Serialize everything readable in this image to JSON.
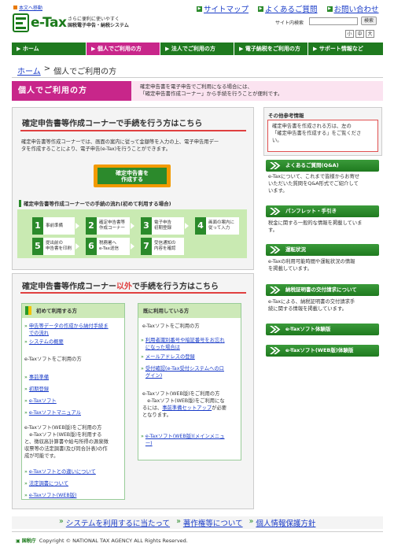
{
  "header": {
    "skip_link": "本文へ移動",
    "logo_text": "e-Tax",
    "logo_sub1": "さらに便利に使いやすく",
    "logo_sub2": "国税電子申告・納税システム",
    "toplinks": [
      "サイトマップ",
      "よくあるご質問",
      "お問い合わせ"
    ],
    "search_label": "サイト内検索",
    "search_button": "検索",
    "size_buttons": [
      "小",
      "中",
      "大"
    ]
  },
  "nav": [
    "ホーム",
    "個人でご利用の方",
    "法人でご利用の方",
    "電子納税をご利用の方",
    "サポート情報など"
  ],
  "breadcrumb": {
    "home": "ホーム",
    "sep": ">",
    "current": "個人でご利用の方"
  },
  "page_head": {
    "title": "個人でご利用の方",
    "desc1": "確定申告書を電子申告でご利用になる場合には、",
    "desc2": "「確定申告書作成コーナー」から手続を行うことが便利です。"
  },
  "main": {
    "title": "確定申告書等作成コーナーで手続を行う方はこちら",
    "text1": "確定申告書等作成コーナーでは、画面の案内に従って金額等を入力の上、電子申告用デー",
    "text2": "タを作成することにより、電子申告(e-Tax)を行うことができます。",
    "button_line1": "確定申告書を",
    "button_line2": "作成する",
    "flow_title": "確定申告書等作成コーナーでの手続の流れ(初めて利用する場合)",
    "steps": [
      {
        "num": "1",
        "l1": "事前準備",
        "l2": ""
      },
      {
        "num": "2",
        "l1": "確定申告書等",
        "l2": "作成コーナー"
      },
      {
        "num": "3",
        "l1": "電子申告",
        "l2": "初期登録"
      },
      {
        "num": "4",
        "l1": "画面の案内に",
        "l2": "従って入力"
      },
      {
        "num": "5",
        "l1": "提出前の",
        "l2": "申告書を印刷"
      },
      {
        "num": "6",
        "l1": "税務署へ",
        "l2": "e-Tax送信"
      },
      {
        "num": "7",
        "l1": "受信通知の",
        "l2": "内容を確認"
      }
    ]
  },
  "other": {
    "title_a": "確定申告書等作成コーナー",
    "title_b": "以外",
    "title_c": "で手続を行う方はこちら",
    "first": {
      "heading": "初めて利用する方",
      "links1": [
        "申告等データの作成から納付手続ま",
        "での流れ",
        "システムの概要"
      ],
      "sec_title": "e-Taxソフトをご利用の方",
      "links2": [
        "事前準備",
        "初期登録",
        "e-Taxソフト",
        "e-Taxソフトマニュアル"
      ],
      "para": [
        "e-Taxソフト(WEB版)をご利用の方",
        "　e-Taxソフト(WEB版)を利用する",
        "と、徴収高計算書や給与所得の源泉徴",
        "収票等の法定調書(及び同合計表)の作",
        "成が可能です。"
      ],
      "links3": [
        "e-Taxソフトとの違いについて",
        "法定調書について",
        "e-Taxソフト(WEB版)"
      ]
    },
    "existing": {
      "heading": "既に利用している方",
      "sec_title": "e-Taxソフトをご利用の方",
      "links1": [
        "利用者識別番号や暗証番号をお忘れ",
        "になった場合は",
        "メールアドレスの登録",
        "受付確認(e-Tax受付システムへのロ",
        "グイン)"
      ],
      "para": [
        "e-Taxソフト(WEB版)をご利用の方",
        "　e-Taxソフト(WEB版)をご利用にな",
        "るには、",
        "事前準備セットアップ",
        "が必要",
        "となります。"
      ],
      "links2": [
        "e-Taxソフト(WEB版)(メインメニュ",
        "ー)"
      ]
    }
  },
  "side": {
    "info_title": "その他参考情報",
    "info_text": [
      "確定申告書を作成される方は、左の",
      "「確定申告書を作成する」をご覧くださ",
      "い。"
    ],
    "sections": [
      {
        "title": "よくあるご質問(Q&A)",
        "text": [
          "e-Taxについて、これまで皆様からお寄せ",
          "いただいた質問をQ&A形式でご紹介して",
          "います。"
        ]
      },
      {
        "title": "パンフレット・手引き",
        "text": [
          "税金に関する一般的な情報を掲載していま",
          "す。"
        ]
      },
      {
        "title": "運転状況",
        "text": [
          "e-Taxの利用可能時間や運転状況の情報",
          "を掲載しています。"
        ]
      },
      {
        "title": "納税証明書の交付請求について",
        "text": [
          "e-Taxによる、納税証明書の交付請求手",
          "続に関する情報を掲載しています。"
        ]
      },
      {
        "title": "e-Taxソフト体験版",
        "text": []
      },
      {
        "title": "e-Taxソフト(WEB版)体験版",
        "text": []
      }
    ]
  },
  "footer": {
    "links": [
      "システムを利用するに当たって",
      "著作権等について",
      "個人情報保護方針"
    ],
    "agency": "国税庁",
    "copyright": "Copyright © NATIONAL TAX AGENCY ALL Rights Reserved."
  },
  "colors": {
    "green": "#1f7a1f",
    "pink": "#c8268a",
    "orange": "#f29a00",
    "link": "#1a3cc8"
  }
}
